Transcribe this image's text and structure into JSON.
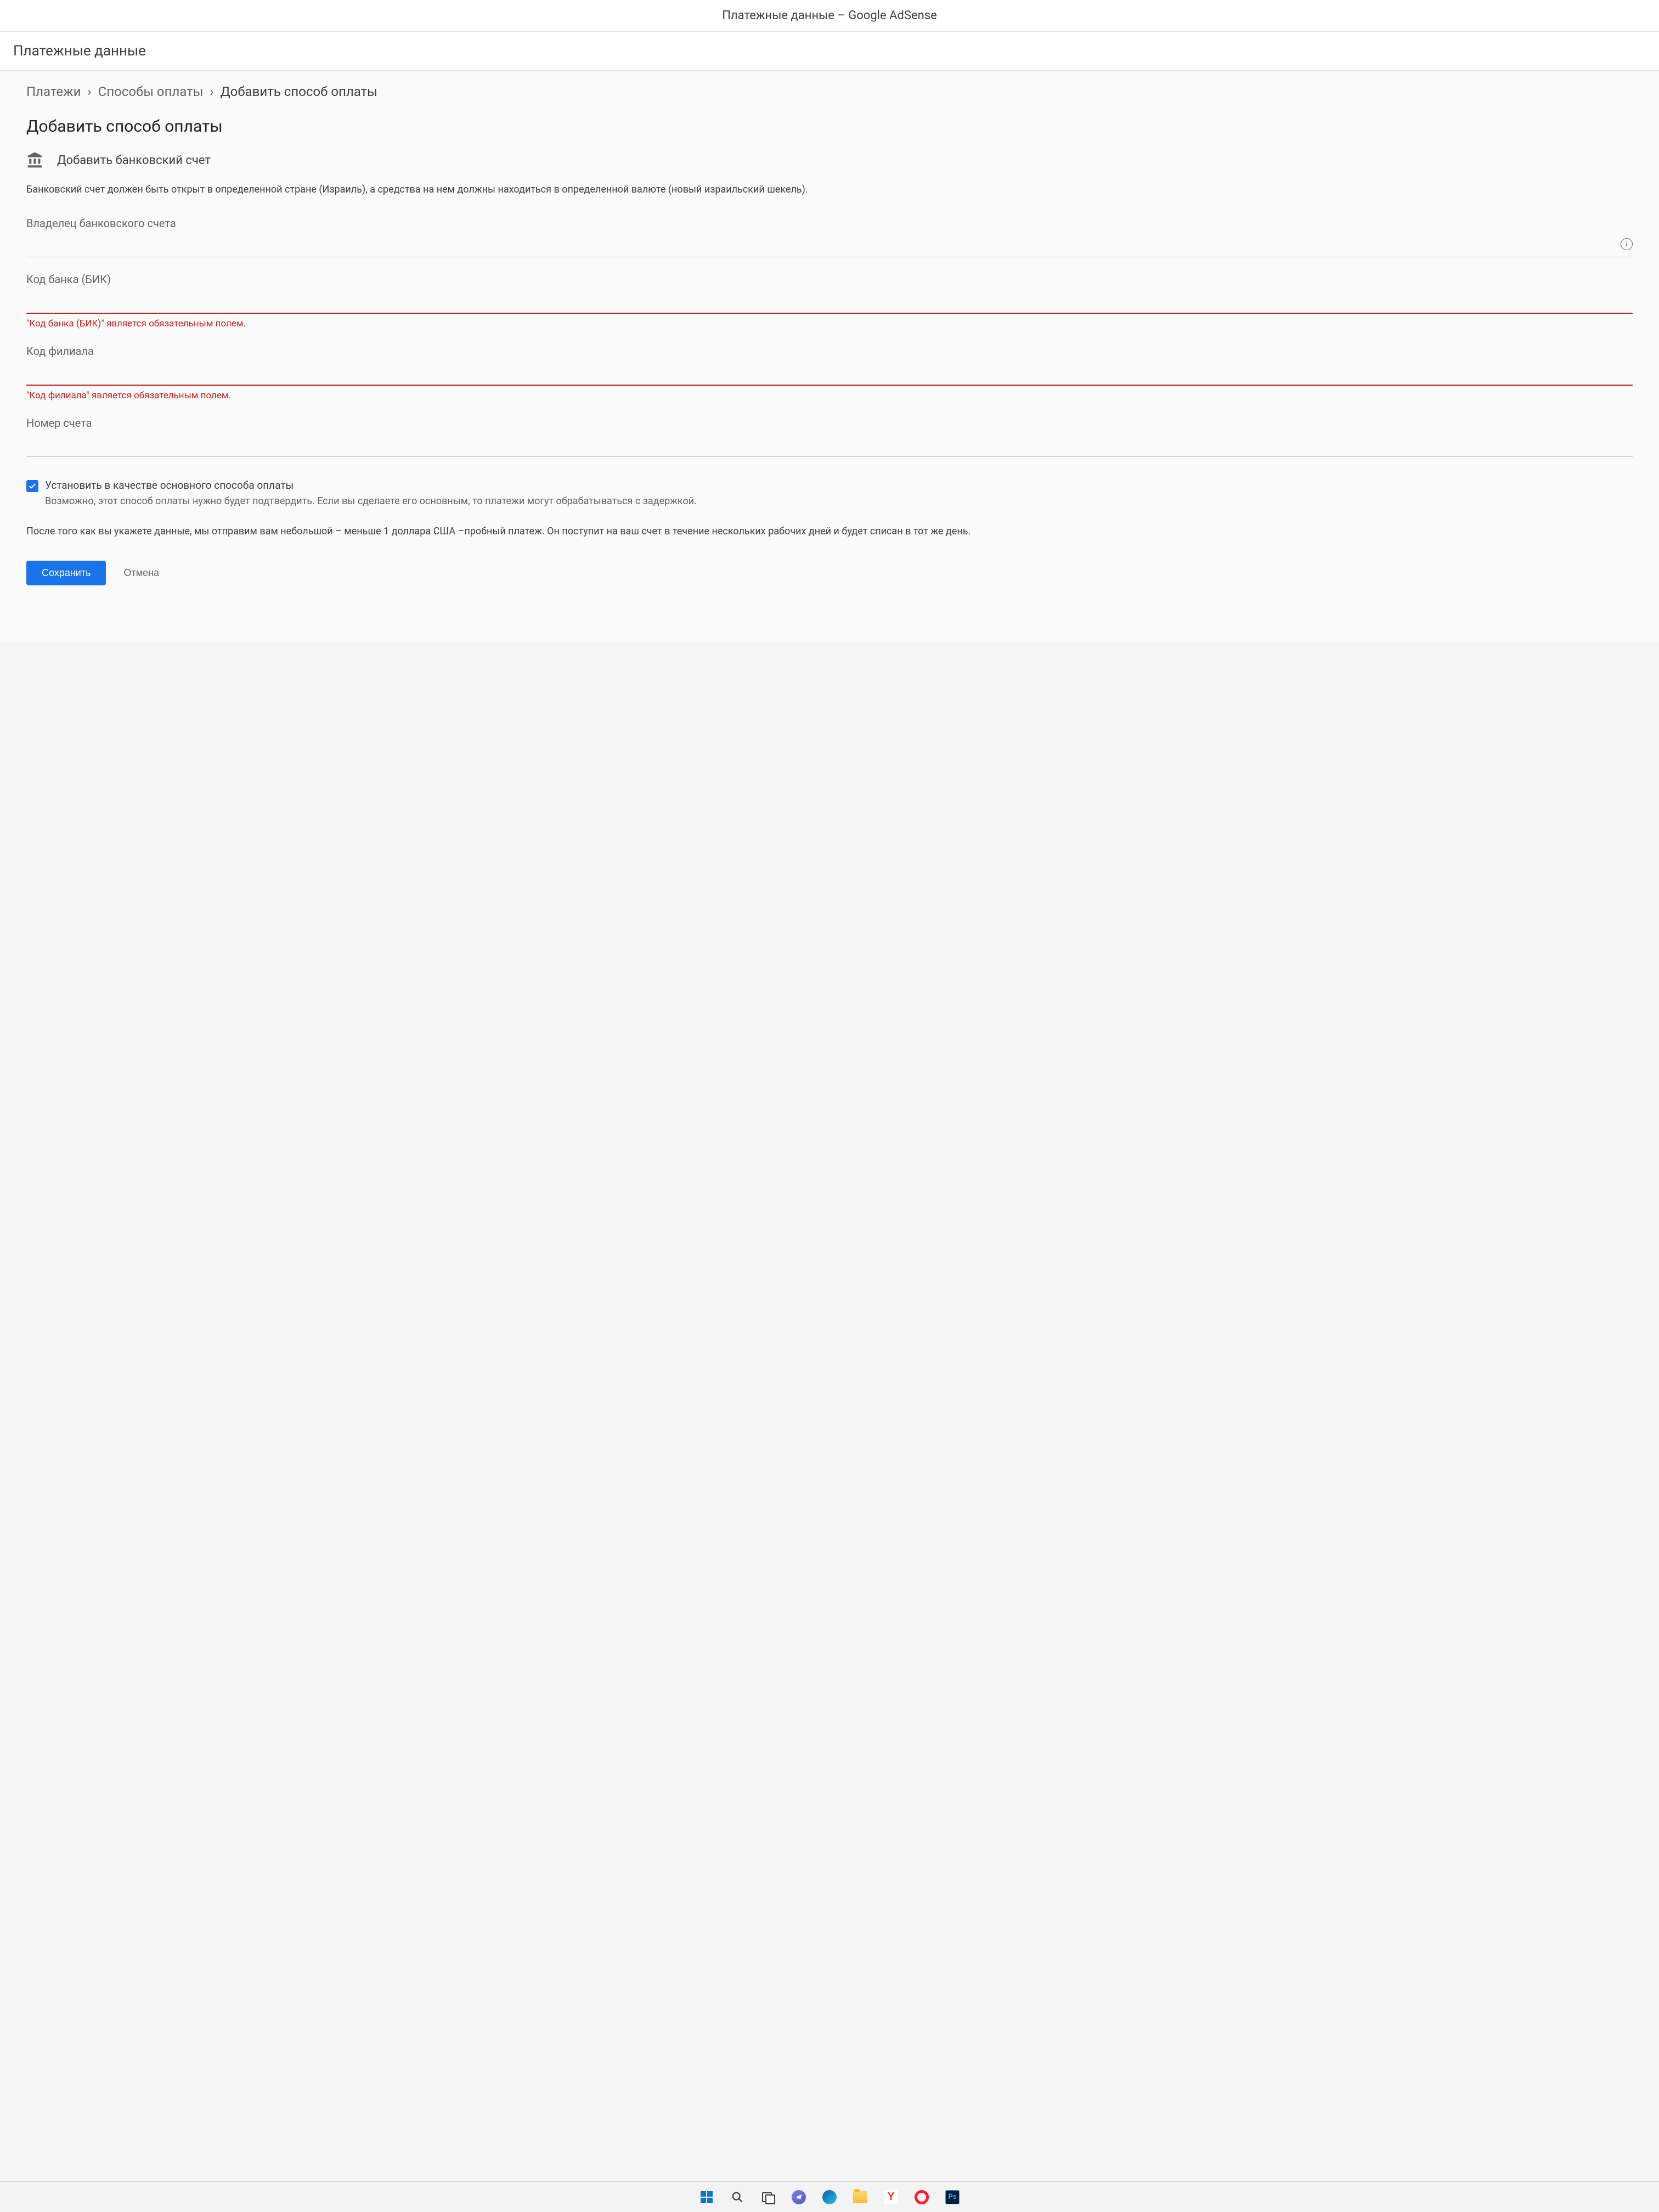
{
  "browser": {
    "title": "Платежные данные – Google AdSense"
  },
  "header": {
    "title": "Платежные данные"
  },
  "breadcrumb": {
    "items": [
      "Платежи",
      "Способы оплаты",
      "Добавить способ оплаты"
    ]
  },
  "page": {
    "title": "Добавить способ оплаты",
    "section_title": "Добавить банковский счет",
    "description": "Банковский счет должен быть открыт в определенной стране (Израиль), а средства на нем должны находиться в определенной валюте (новый израильский шекель)."
  },
  "fields": {
    "owner": {
      "label": "Владелец банковского счета",
      "value": ""
    },
    "bank_code": {
      "label": "Код банка (БИК)",
      "value": "",
      "error": "\"Код банка (БИК)\" является обязательным полем."
    },
    "branch_code": {
      "label": "Код филиала",
      "value": "",
      "error": "\"Код филиала\" является обязательным полем."
    },
    "account_number": {
      "label": "Номер счета",
      "value": ""
    }
  },
  "checkbox": {
    "label": "Установить в качестве основного способа оплаты",
    "help": "Возможно, этот способ оплаты нужно будет подтвердить. Если вы сделаете его основным, то платежи могут обрабатываться с задержкой.",
    "checked": true
  },
  "disclaimer": "После того как вы укажете данные, мы отправим вам небольшой – меньше 1 доллара США –пробный платеж. Он поступит на ваш счет в течение нескольких рабочих дней и будет списан в тот же день.",
  "actions": {
    "save": "Сохранить",
    "cancel": "Отмена"
  },
  "taskbar": {
    "yandex": "Y",
    "ps": "Ps"
  }
}
